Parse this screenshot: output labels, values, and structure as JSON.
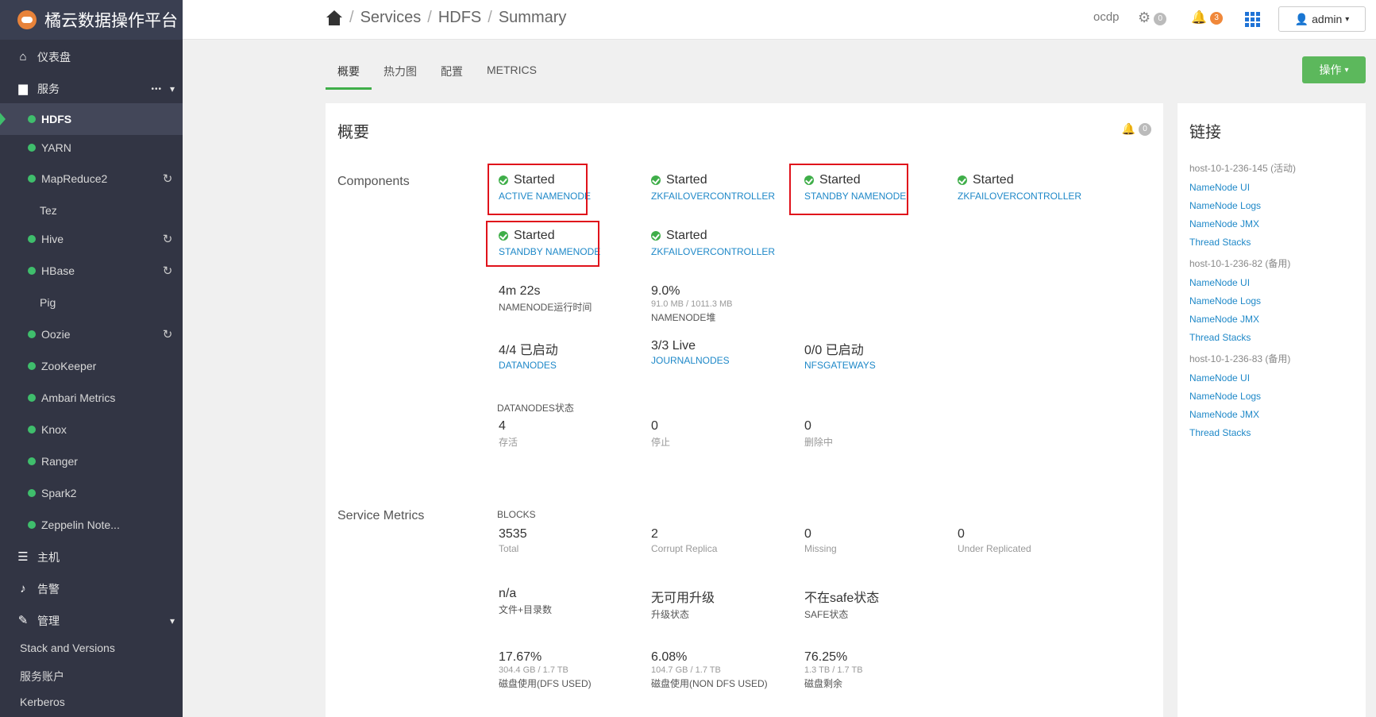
{
  "app": {
    "title": "橘云数据操作平台"
  },
  "sidebar": {
    "dashboard": "仪表盘",
    "services": "服务",
    "services_more": "•••",
    "service_list": [
      {
        "name": "HDFS",
        "status": "green",
        "active": true,
        "refresh": false
      },
      {
        "name": "YARN",
        "status": "green",
        "refresh": false
      },
      {
        "name": "MapReduce2",
        "status": "green",
        "refresh": true
      },
      {
        "name": "Tez",
        "status": "none",
        "refresh": false
      },
      {
        "name": "Hive",
        "status": "green",
        "refresh": true
      },
      {
        "name": "HBase",
        "status": "green",
        "refresh": true
      },
      {
        "name": "Pig",
        "status": "none",
        "refresh": false
      },
      {
        "name": "Oozie",
        "status": "green",
        "refresh": true
      },
      {
        "name": "ZooKeeper",
        "status": "green",
        "refresh": false
      },
      {
        "name": "Ambari Metrics",
        "status": "green",
        "refresh": false
      },
      {
        "name": "Knox",
        "status": "green",
        "refresh": false
      },
      {
        "name": "Ranger",
        "status": "green",
        "refresh": false
      },
      {
        "name": "Spark2",
        "status": "green",
        "refresh": false
      },
      {
        "name": "Zeppelin Note...",
        "status": "green",
        "refresh": false
      }
    ],
    "hosts": "主机",
    "alerts": "告警",
    "admin": "管理",
    "admin_links": [
      "Stack and Versions",
      "服务账户",
      "Kerberos"
    ]
  },
  "topbar": {
    "breadcrumb": [
      "Services",
      "HDFS",
      "Summary"
    ],
    "cluster": "ocdp",
    "ops_count": "0",
    "alerts_count": "3",
    "user": "admin"
  },
  "tabs": [
    "概要",
    "热力图",
    "配置",
    "METRICS"
  ],
  "action_button": "操作",
  "summary": {
    "title": "概要",
    "alert_count": "0",
    "components_label": "Components",
    "components": [
      {
        "status": "Started",
        "name": "ACTIVE NAMENODE"
      },
      {
        "status": "Started",
        "name": "ZKFAILOVERCONTROLLER"
      },
      {
        "status": "Started",
        "name": "STANDBY NAMENODE"
      },
      {
        "status": "Started",
        "name": "ZKFAILOVERCONTROLLER"
      },
      {
        "status": "Started",
        "name": "STANDBY NAMENODE"
      },
      {
        "status": "Started",
        "name": "ZKFAILOVERCONTROLLER"
      }
    ],
    "uptime": {
      "value": "4m 22s",
      "label": "NAMENODE运行时间"
    },
    "heap": {
      "value": "9.0%",
      "detail": "91.0 MB / 1011.3 MB",
      "label": "NAMENODE堆"
    },
    "datanodes": {
      "value": "4/4 已启动",
      "label": "DATANODES"
    },
    "journalnodes": {
      "value": "3/3 Live",
      "label": "JOURNALNODES"
    },
    "nfsgateways": {
      "value": "0/0 已启动",
      "label": "NFSGATEWAYS"
    },
    "datanode_status_head": "DATANODES状态",
    "datanode_status": [
      {
        "value": "4",
        "label": "存活"
      },
      {
        "value": "0",
        "label": "停止"
      },
      {
        "value": "0",
        "label": "删除中"
      }
    ],
    "service_metrics_label": "Service Metrics",
    "blocks_head": "BLOCKS",
    "blocks": [
      {
        "value": "3535",
        "label": "Total"
      },
      {
        "value": "2",
        "label": "Corrupt Replica"
      },
      {
        "value": "0",
        "label": "Missing"
      },
      {
        "value": "0",
        "label": "Under Replicated"
      }
    ],
    "files": {
      "value": "n/a",
      "label": "文件+目录数"
    },
    "upgrade": {
      "value": "无可用升级",
      "label": "升级状态"
    },
    "safe": {
      "value": "不在safe状态",
      "label": "SAFE状态"
    },
    "disk": [
      {
        "value": "17.67%",
        "detail": "304.4 GB / 1.7 TB",
        "label": "磁盘使用(DFS USED)"
      },
      {
        "value": "6.08%",
        "detail": "104.7 GB / 1.7 TB",
        "label": "磁盘使用(NON DFS USED)"
      },
      {
        "value": "76.25%",
        "detail": "1.3 TB / 1.7 TB",
        "label": "磁盘剩余"
      }
    ]
  },
  "links": {
    "title": "链接",
    "hosts": [
      {
        "host": "host-10-1-236-145 (活动)",
        "items": [
          "NameNode UI",
          "NameNode Logs",
          "NameNode JMX",
          "Thread Stacks"
        ]
      },
      {
        "host": "host-10-1-236-82 (备用)",
        "items": [
          "NameNode UI",
          "NameNode Logs",
          "NameNode JMX",
          "Thread Stacks"
        ]
      },
      {
        "host": "host-10-1-236-83 (备用)",
        "items": [
          "NameNode UI",
          "NameNode Logs",
          "NameNode JMX",
          "Thread Stacks"
        ]
      }
    ]
  },
  "colors": {
    "sidebar": "#323544",
    "accent_green": "#3fae49",
    "link": "#1e88c8",
    "highlight": "#e0121b"
  }
}
